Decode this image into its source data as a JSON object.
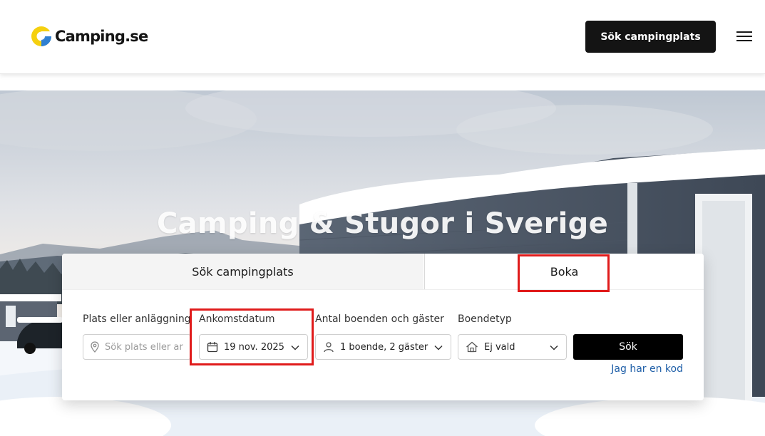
{
  "header": {
    "logo_text": "Camping.se",
    "search_button": "Sök campingplats",
    "menu_icon": "hamburger-menu-icon"
  },
  "hero": {
    "title": "Camping & Stugor i Sverige"
  },
  "booking": {
    "tabs": [
      {
        "label": "Sök campingplats",
        "active": false
      },
      {
        "label": "Boka",
        "active": true
      }
    ],
    "fields": {
      "location": {
        "label": "Plats eller anläggning",
        "placeholder": "Sök plats eller ar",
        "icon": "map-pin-icon"
      },
      "arrival": {
        "label": "Ankomstdatum",
        "value": "19 nov. 2025",
        "icon": "calendar-icon"
      },
      "guests": {
        "label": "Antal boenden och gäster",
        "value": "1 boende, 2 gäster",
        "icon": "person-icon"
      },
      "type": {
        "label": "Boendetyp",
        "value": "Ej vald",
        "icon": "house-icon"
      }
    },
    "search_button": "Sök",
    "code_link": "Jag har en kod"
  },
  "colors": {
    "header_button_bg": "#141414",
    "search_button_bg": "#000000",
    "link": "#1f5fa8",
    "highlight": "#e01b1b",
    "logo_yellow": "#f5d00f",
    "logo_blue": "#2f7fd2"
  }
}
